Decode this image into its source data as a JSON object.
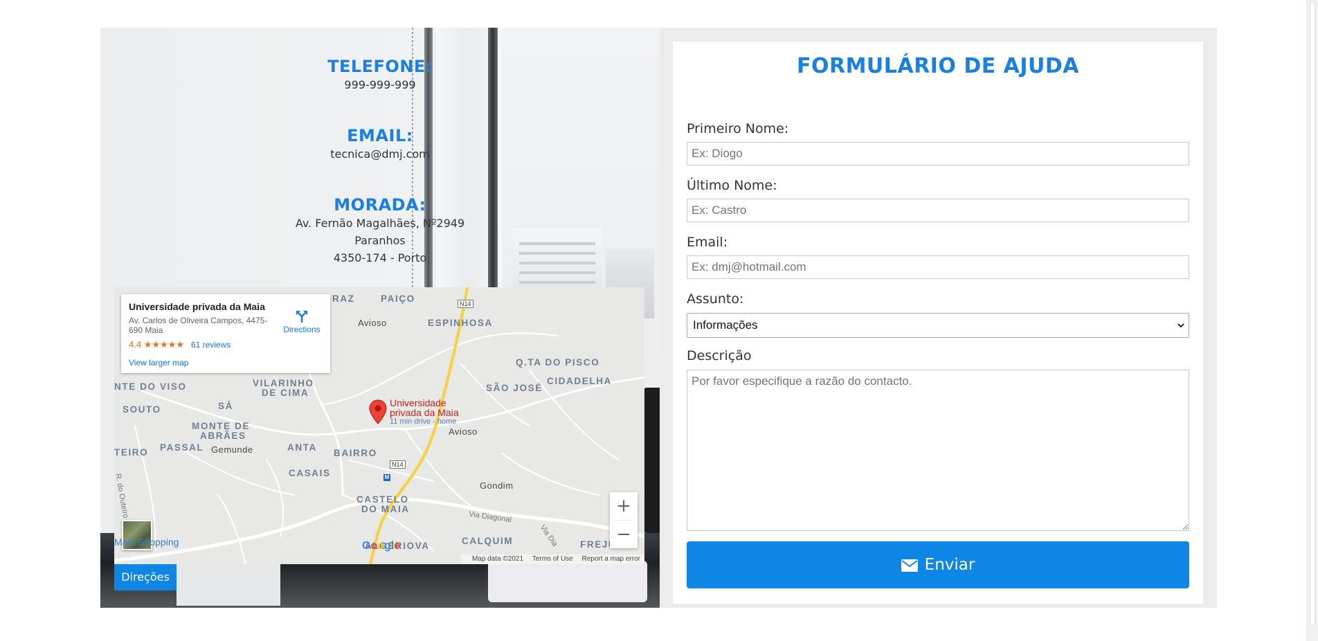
{
  "contact": {
    "phone_title": "TELEFONE:",
    "phone": "999-999-999",
    "email_title": "EMAIL:",
    "email": "tecnica@dmj.com",
    "address_title": "MORADA:",
    "address_lines": [
      "Av. Fernão Magalhães, Nº2949",
      "Paranhos",
      "4350-174 - Porto"
    ]
  },
  "map": {
    "place_name": "Universidade privada da Maia",
    "place_address": "Av. Carlos de Oliveira Campos, 4475-690 Maia",
    "rating": "4.4",
    "stars": "★★★★★",
    "reviews": "61 reviews",
    "larger_map": "View larger map",
    "directions": "Directions",
    "pin_name_line1": "Universidade",
    "pin_name_line2": "privada da Maia",
    "pin_drive": "11 min drive - home",
    "places": {
      "raz": "RAZ",
      "paico": "PAIÇO",
      "avioso_n": "Avioso",
      "espinhosa": "ESPINHOSA",
      "q_pisco": "Q.TA DO PISCO",
      "cidadelha": "CIDADELHA",
      "sao_jose": "SÃO JOSÉ",
      "monte_viso": "NTE DO VISO",
      "vilarinho": "VILARINHO",
      "de_cima": "DE CIMA",
      "souto": "SOUTO",
      "sa": "SÁ",
      "monte_abraes": "MONTE DE",
      "abraes": "ABRÃES",
      "avioso_s": "Avioso",
      "teiro": "TEIRO",
      "passal": "PASSAL",
      "gemunde": "Gemunde",
      "anta": "ANTA",
      "bairro": "BAIRRO",
      "casais": "CASAIS",
      "gondim": "Gondim",
      "castelo": "CASTELO",
      "do_maia": "DO MAIA",
      "via_diagonal": "Via Diagonal",
      "calquim": "CALQUIM",
      "frejulfe": "FREJULFE",
      "algeriova": "ALGERIOVA",
      "r_outeiro": "R. do Outeiro",
      "via_dia": "Via Dia",
      "n14_a": "N14",
      "n14_b": "N14",
      "metro": "M",
      "shopping": "Maia Shopping"
    },
    "zoom_in": "+",
    "zoom_out": "−",
    "google": "Google",
    "map_data": "Map data ©2021",
    "terms": "Terms of Use",
    "report": "Report a map error"
  },
  "directions_button": "Direções",
  "form": {
    "title": "FORMULÁRIO DE AJUDA",
    "first_name_label": "Primeiro Nome:",
    "first_name_placeholder": "Ex: Diogo",
    "last_name_label": "Último Nome:",
    "last_name_placeholder": "Ex: Castro",
    "email_label": "Email:",
    "email_placeholder": "Ex: dmj@hotmail.com",
    "subject_label": "Assunto:",
    "subject_value": "Informações",
    "description_label": "Descrição",
    "description_placeholder": "Por favor especifique a razão do contacto.",
    "submit": "Enviar"
  },
  "colors": {
    "accent": "#1a7fe0",
    "button": "#0e86e6"
  }
}
